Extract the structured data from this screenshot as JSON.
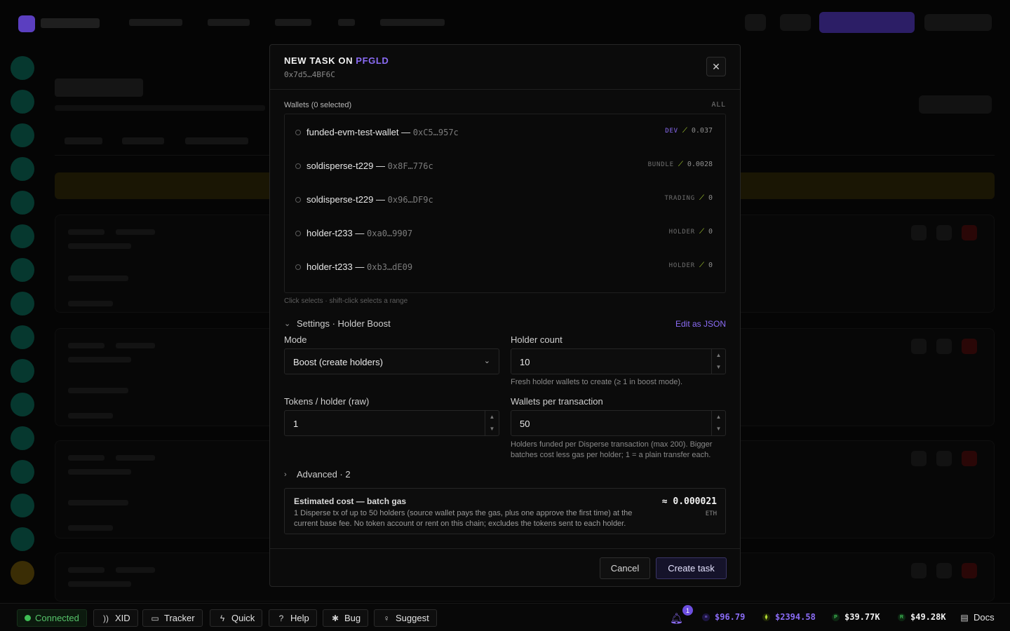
{
  "modal": {
    "title_prefix": "NEW TASK ON",
    "token": "PFGLD",
    "address": "0x7d5…4BF6C",
    "close_icon": "close-icon",
    "wallets_label": "Wallets (0 selected)",
    "all_label": "ALL",
    "wallets": [
      {
        "name": "funded-evm-test-wallet",
        "address": "0xC5…957c",
        "tag": "DEV",
        "balance": "0.037"
      },
      {
        "name": "soldisperse-t229",
        "address": "0x8F…776c",
        "tag": "BUNDLE",
        "balance": "0.0028"
      },
      {
        "name": "soldisperse-t229",
        "address": "0x96…DF9c",
        "tag": "TRADING",
        "balance": "0"
      },
      {
        "name": "holder-t233",
        "address": "0xa0…9907",
        "tag": "HOLDER",
        "balance": "0"
      },
      {
        "name": "holder-t233",
        "address": "0xb3…dE09",
        "tag": "HOLDER",
        "balance": "0"
      }
    ],
    "dash": "—",
    "hint": "Click selects · shift-click selects a range",
    "settings_label": "Settings · Holder Boost",
    "edit_json": "Edit as JSON",
    "mode": {
      "label": "Mode",
      "value": "Boost (create holders)"
    },
    "holder_count": {
      "label": "Holder count",
      "value": "10",
      "help": "Fresh holder wallets to create (≥ 1 in boost mode)."
    },
    "tokens_per_holder": {
      "label": "Tokens / holder (raw)",
      "value": "1"
    },
    "wallets_per_tx": {
      "label": "Wallets per transaction",
      "value": "50",
      "help": "Holders funded per Disperse transaction (max 200). Bigger batches cost less gas per holder; 1 = a plain transfer each."
    },
    "advanced_label": "Advanced · 2",
    "cost": {
      "title": "Estimated cost — batch gas",
      "description": "1 Disperse tx of up to 50 holders (source wallet pays the gas, plus one approve the first time) at the current base fee. No token account or rent on this chain; excludes the tokens sent to each holder.",
      "value": "≈ 0.000021",
      "unit": "ETH"
    },
    "cancel": "Cancel",
    "create": "Create task"
  },
  "bottombar": {
    "connected": "Connected",
    "xid": "XID",
    "tracker": "Tracker",
    "quick": "Quick",
    "help": "Help",
    "bug": "Bug",
    "suggest": "Suggest",
    "notifications_count": "1",
    "prices": [
      {
        "symbol": "≡",
        "value": "$96.79",
        "color": "#8b6cf6"
      },
      {
        "symbol": "⧫",
        "value": "$2394.58",
        "color": "#b6e034"
      },
      {
        "symbol": "P",
        "value": "$39.77K",
        "color": "#3fbf55"
      },
      {
        "symbol": "R",
        "value": "$49.28K",
        "color": "#3fbf55"
      }
    ],
    "docs": "Docs"
  },
  "colors": {
    "accent": "#8b6cf6",
    "success": "#3fbf55",
    "gas": "#b6e034"
  }
}
